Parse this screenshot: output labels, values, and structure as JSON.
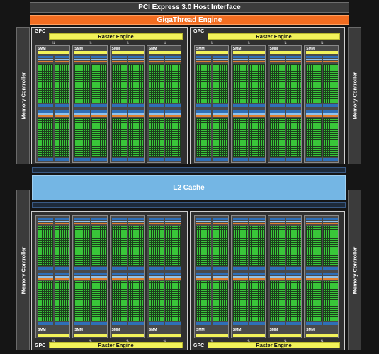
{
  "pci": {
    "label": "PCI Express 3.0 Host Interface"
  },
  "giga": {
    "label": "GigaThread Engine"
  },
  "memory_controller": {
    "label": "Memory Controller"
  },
  "l2": {
    "label": "L2 Cache"
  },
  "gpc": {
    "label": "GPC"
  },
  "raster": {
    "label": "Raster Engine"
  },
  "smm": {
    "label": "SMM"
  },
  "colors": {
    "background": "#151515",
    "giga": "#f26d21",
    "raster": "#f2f25a",
    "l2": "#74b6e4",
    "cores": "#39c639",
    "units": "#2e6fb8"
  }
}
